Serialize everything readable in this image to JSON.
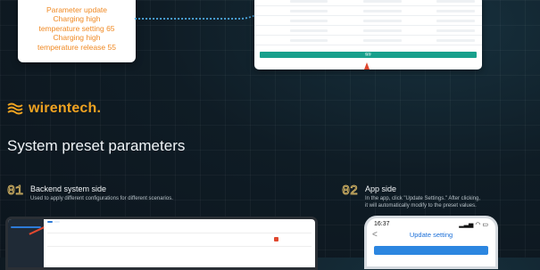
{
  "left_card": {
    "lines": [
      "Parameter update",
      "Charging high",
      "temperature setting 65",
      "Charging high",
      "temperature release 55"
    ]
  },
  "top_table": {
    "save_label": "保存"
  },
  "brand": {
    "name": "wirentech.",
    "logo_icon": "wave-lines-icon",
    "color": "#f0a321"
  },
  "section": {
    "title": "System preset parameters"
  },
  "steps": [
    {
      "number": "01",
      "title": "Backend system side",
      "description": "Used to apply different configurations for different scenarios."
    },
    {
      "number": "02",
      "title": "App side",
      "description_lines": [
        "In the app, click \"Update Settings.\" After clicking,",
        "it will automatically modify to the preset values."
      ]
    }
  ],
  "phone": {
    "time": "16:37",
    "status_icons": "signal-wifi-battery-icon",
    "title": "Update setting",
    "back_icon": "chevron-left-icon"
  }
}
